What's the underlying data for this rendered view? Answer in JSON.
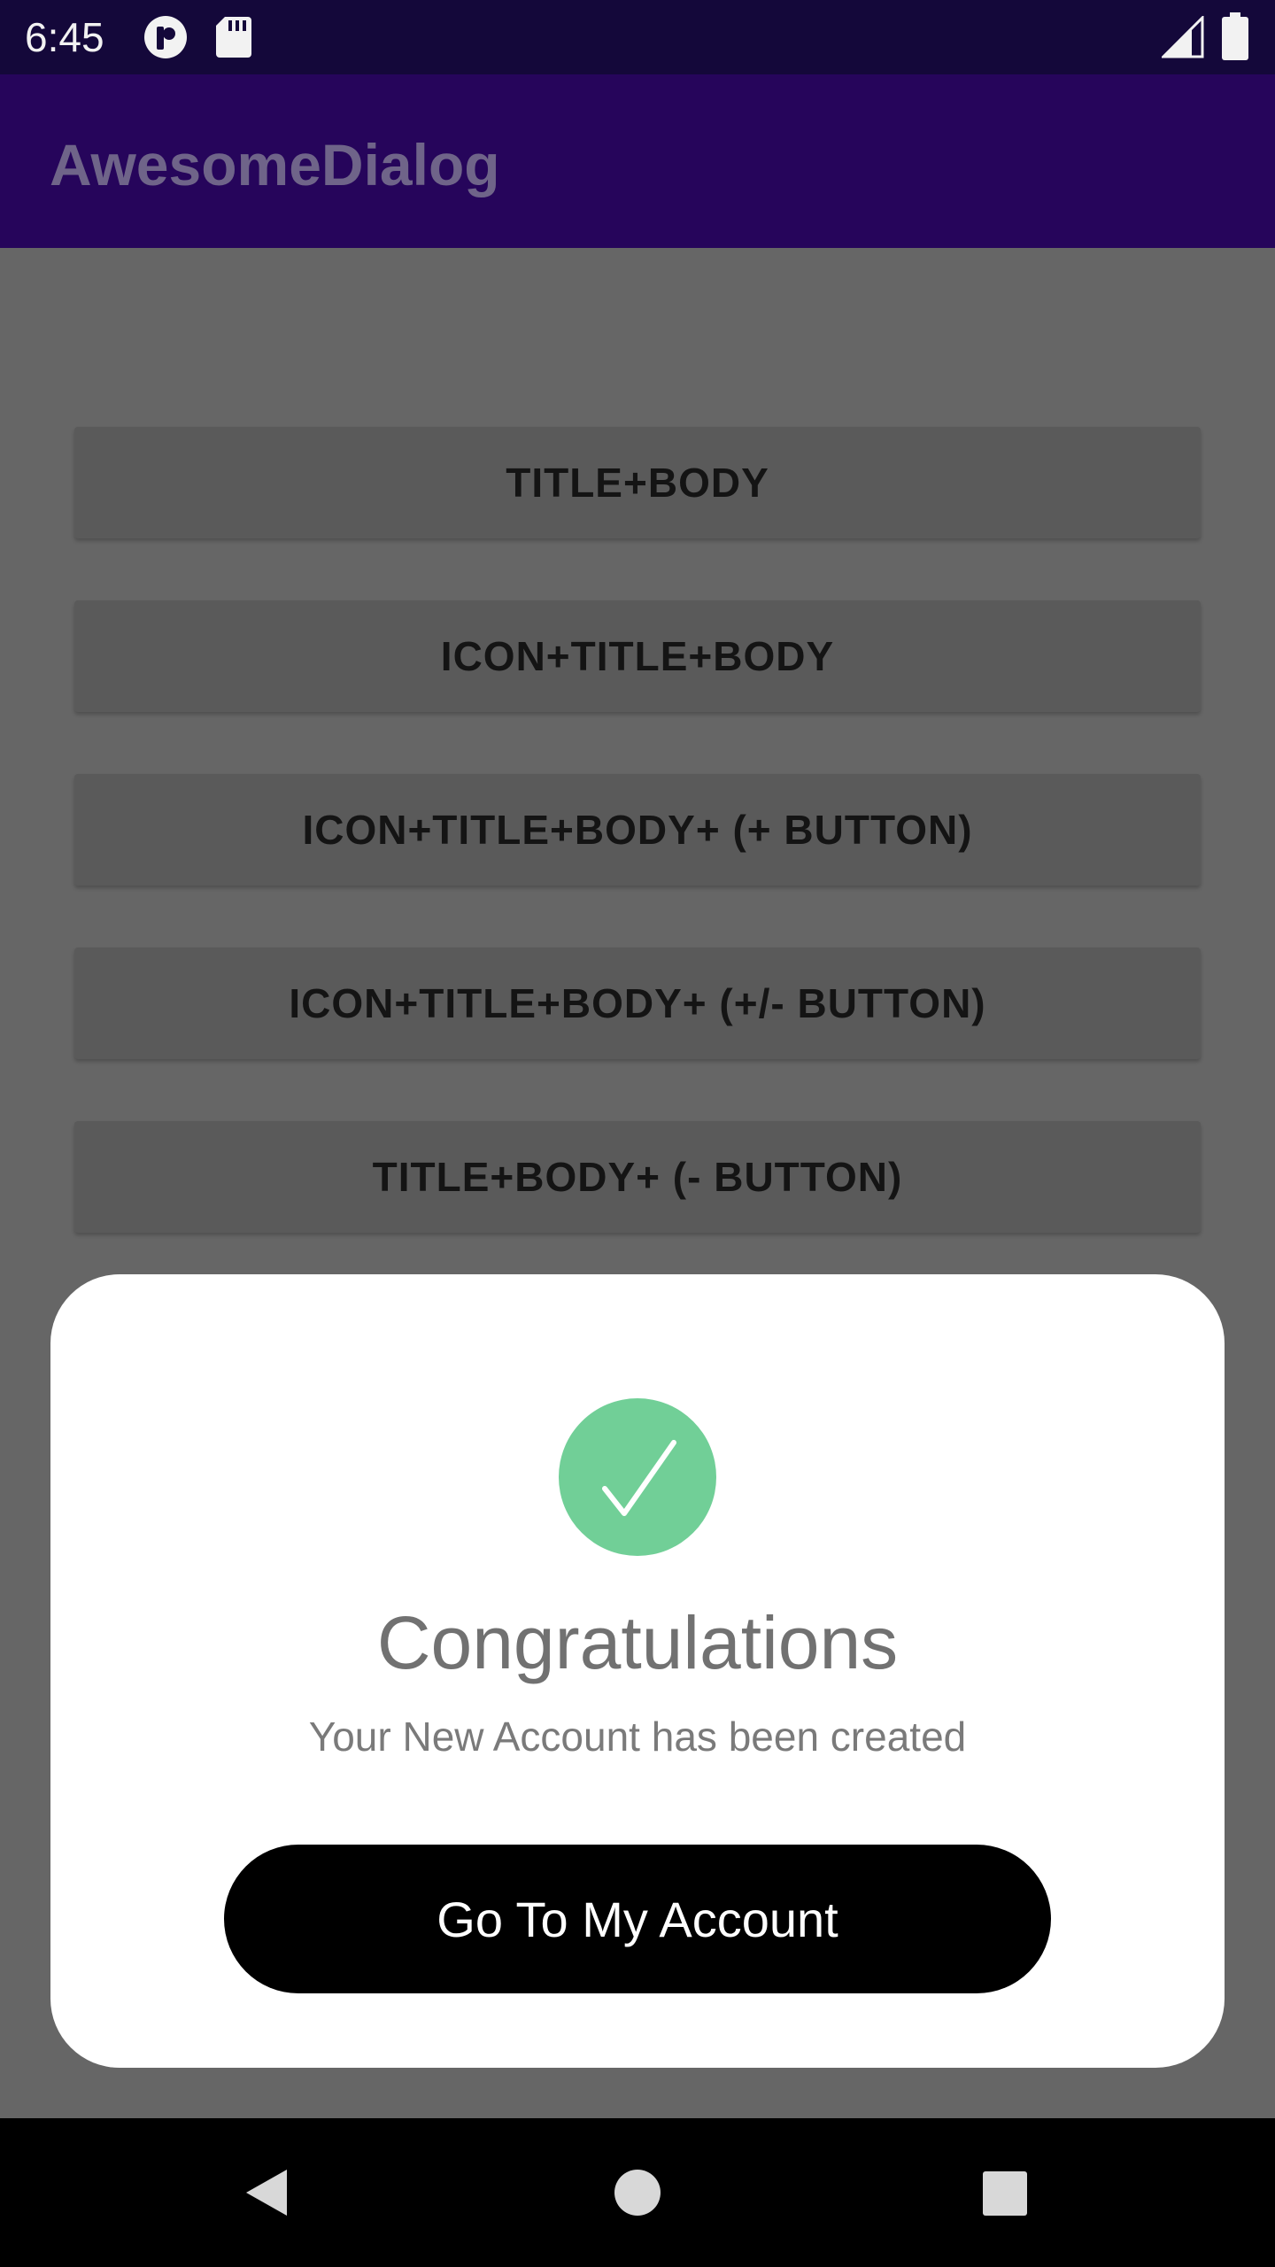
{
  "status_bar": {
    "time": "6:45",
    "icons": [
      "notification-app-icon",
      "sd-card-icon",
      "signal-icon",
      "battery-icon"
    ]
  },
  "app_bar": {
    "title": "AwesomeDialog"
  },
  "buttons": [
    {
      "label": "TITLE+BODY"
    },
    {
      "label": "ICON+TITLE+BODY"
    },
    {
      "label": "ICON+TITLE+BODY+ (+ BUTTON)"
    },
    {
      "label": "ICON+TITLE+BODY+ (+/- BUTTON)"
    },
    {
      "label": "TITLE+BODY+ (- BUTTON)"
    }
  ],
  "dialog": {
    "icon": "check-icon",
    "icon_color": "#71cf97",
    "title": "Congratulations",
    "body": "Your New Account has been created",
    "action_label": "Go To My Account"
  },
  "nav_bar": {
    "icons": [
      "back-icon",
      "home-icon",
      "recents-icon"
    ]
  },
  "colors": {
    "status_bar": "#14083a",
    "app_bar": "#26055b",
    "scrim": "#666666",
    "dialog_action": "#000000"
  }
}
